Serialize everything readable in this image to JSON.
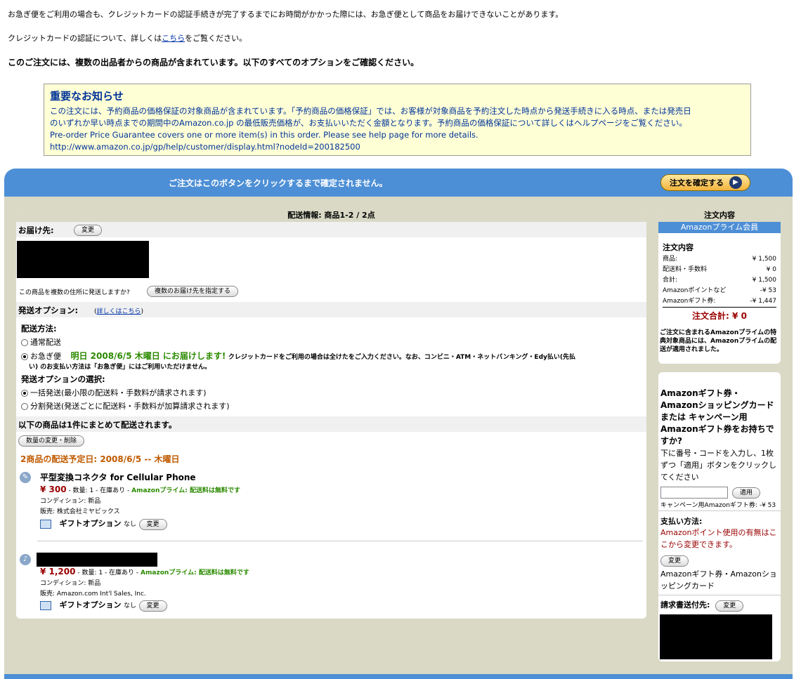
{
  "top": {
    "line1": "お急ぎ便をご利用の場合も、クレジットカードの認証手続きが完了するまでにお時間がかかった際には、お急ぎ便として商品をお届けできないことがあります。",
    "line2_prefix": "クレジットカードの認証について、詳しくは",
    "line2_link": "こちら",
    "line2_suffix": "をご覧ください。",
    "line3": "このご注文には、複数の出品者からの商品が含まれています。以下のすべてのオプションをご確認ください。"
  },
  "notice": {
    "title": "重要なお知らせ",
    "body1": "この注文には、予約商品の価格保証の対象商品が含まれています。「予約商品の価格保証」では、お客様が対象商品を予約注文した時点から発送手続きに入る時点、または発売日",
    "body2": "のいずれか早い時点までの期間中のAmazon.co.jp の最低販売価格が、お支払いいただく金額となります。予約商品の価格保証について詳しくはヘルプページをご覧ください。",
    "body3": "Pre-order Price Guarantee covers one or more item(s) in this order. Please see help page for more details.",
    "body4": "http://www.amazon.co.jp/gp/help/customer/display.html?nodeId=200182500"
  },
  "bar": {
    "message": "ご注文はこのボタンをクリックするまで確定されません。",
    "confirm_label": "注文を確定する"
  },
  "shipping": {
    "header": "配送情報: 商品1-2 /  2点",
    "deliver_to_label": "お届け先:",
    "change_label": "変更",
    "multi_addr_question": "この商品を複数の住所に発送しますか?",
    "multi_addr_button": "複数のお届け先を指定する",
    "ship_option_label": "発送オプション:",
    "ship_option_link": "詳しくはこちら",
    "method_label": "配送方法:",
    "method_normal": "通常配送",
    "method_express": "お急ぎ便",
    "express_date": "明日 2008/6/5 木曜日 にお届けします!",
    "express_note1": "クレジットカードをご利用の場合は全けたをご入力ください。なお、コンビニ・ATM・ネットバンキング・Edy払い(先払",
    "express_note2": "い) のお支払い方法は「お急ぎ便」にはご利用いただけません。",
    "option_select_label": "発送オプションの選択:",
    "option_bulk": "一括発送(最小限の配送料・手数料が請求されます)",
    "option_split": "分割発送(発送ごとに配送料・手数料が加算請求されます)",
    "together_label": "以下の商品は1件にまとめて配送されます。",
    "qty_button": "数量の変更・削除",
    "delivery_date": "2商品の配送予定日: 2008/6/5 -- 木曜日"
  },
  "items": [
    {
      "title": "平型変換コネクタ for Cellular Phone",
      "price": "¥ 300",
      "qty_stock": "- 数量: 1 - 在庫あり -",
      "prime": "Amazonプライム: 配送料は無料です",
      "condition": "コンディション: 新品",
      "seller": "販売: 株式会社ミヤビックス",
      "gift_label": "ギフトオプション",
      "gift_value": "なし",
      "change_label": "変更"
    },
    {
      "title": "",
      "price": "¥ 1,200",
      "qty_stock": "- 数量: 1 - 在庫あり -",
      "prime": "Amazonプライム: 配送料は無料です",
      "condition": "コンディション: 新品",
      "seller": "販売: Amazon.com Int'l Sales, Inc.",
      "gift_label": "ギフトオプション",
      "gift_value": "なし",
      "change_label": "変更"
    }
  ],
  "summary": {
    "header": "注文内容",
    "prime_member": "Amazonプライム会員",
    "subtitle": "注文内容",
    "rows": [
      {
        "label": "商品:",
        "value": "¥ 1,500"
      },
      {
        "label": "配送料・手数料",
        "value": "¥ 0"
      },
      {
        "label": "合計:",
        "value": "¥ 1,500"
      },
      {
        "label": "Amazonポイントなど",
        "value": "-¥ 53"
      },
      {
        "label": "Amazonギフト券:",
        "value": "-¥ 1,447"
      }
    ],
    "total_label": "注文合計:",
    "total_value": "¥ 0",
    "prime_note": "ご注文に含まれるAmazonプライムの特典対象商品には、Amazonプライムの配送が適用されました。"
  },
  "payment": {
    "gift_title": "Amazonギフト券・Amazonショッピングカードまたは キャンペーン用Amazonギフト券をお持ちですか?",
    "gift_instr": "下に番号・コードを入力し、1枚ずつ「適用」ボタンをクリックしてください",
    "apply_label": "適用",
    "campaign_line": "キャンペーン用Amazonギフト券: -¥ 53",
    "method_title": "支払い方法:",
    "method_note": "Amazonポイント使用の有無はここから変更できます。",
    "change_label": "変更",
    "method_value": "Amazonギフト券・Amazonショッピングカード",
    "billing_label": "請求書送付先:",
    "billing_change": "変更"
  },
  "colors": {
    "bar_blue": "#4d8fd6",
    "panel_beige": "#d9d9c6",
    "notice_bg": "#ffffd6",
    "prime_green": "#2b8a00",
    "date_orange": "#c05a00",
    "price_red": "#990000"
  }
}
